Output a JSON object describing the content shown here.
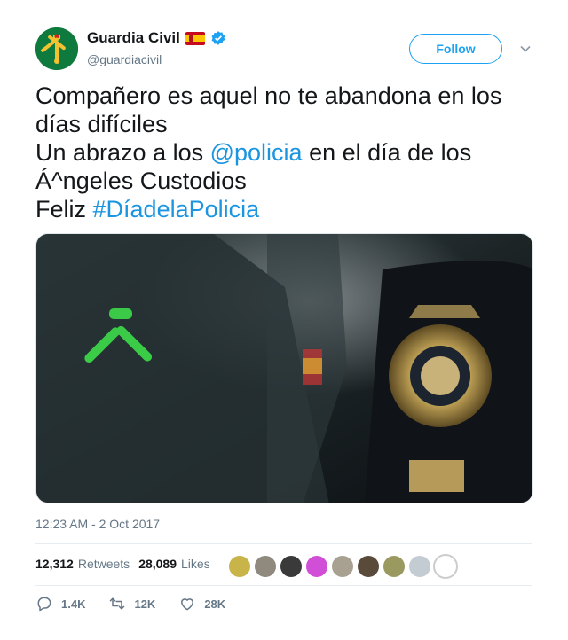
{
  "account": {
    "display_name": "Guardia Civil",
    "handle": "@guardiacivil",
    "verified": true,
    "flag": "spain-flag-icon"
  },
  "follow_button": {
    "label": "Follow"
  },
  "tweet": {
    "lines": [
      [
        {
          "text": "Compañero es aquel no te abandona en los",
          "link": false
        }
      ],
      [
        {
          "text": "días difíciles",
          "link": false
        }
      ],
      [
        {
          "text": "Un abrazo a los ",
          "link": false
        },
        {
          "text": "@policia",
          "link": true
        },
        {
          "text": " en el día de los",
          "link": false
        }
      ],
      [
        {
          "text": "Á^ngeles Custodios",
          "link": false
        }
      ],
      [
        {
          "text": "Feliz ",
          "link": false
        },
        {
          "text": "#DíadelaPolicia",
          "link": true
        }
      ]
    ],
    "timestamp": "12:23 AM - 2 Oct 2017"
  },
  "stats": {
    "retweets_count": "12,312",
    "retweets_label": "Retweets",
    "likes_count": "28,089",
    "likes_label": "Likes"
  },
  "likers": [
    "#c9b44a",
    "#8f8a7d",
    "#3a3a3a",
    "#d14fd6",
    "#a8a090",
    "#5a4a3a",
    "#9a9a60",
    "#c4ccd3",
    "#ffffff"
  ],
  "actions": {
    "reply_count": "1.4K",
    "retweet_count": "12K",
    "like_count": "28K"
  },
  "colors": {
    "link": "#1b95e0",
    "accent": "#1da1f2",
    "muted": "#657786"
  }
}
